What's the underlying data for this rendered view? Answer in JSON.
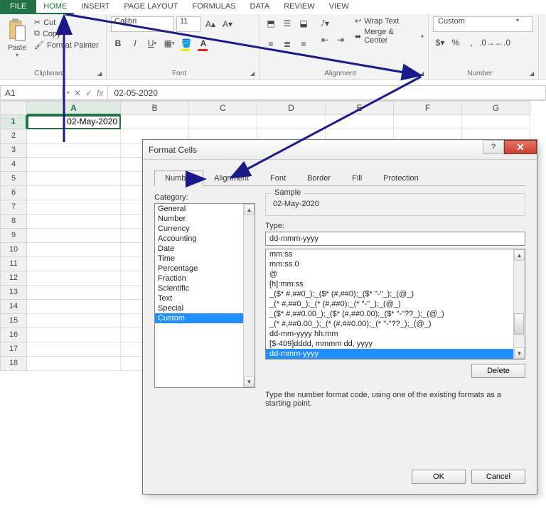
{
  "tabs": {
    "file": "FILE",
    "home": "HOME",
    "insert": "INSERT",
    "pagelayout": "PAGE LAYOUT",
    "formulas": "FORMULAS",
    "data": "DATA",
    "review": "REVIEW",
    "view": "VIEW"
  },
  "ribbon": {
    "clipboard": {
      "paste": "Paste",
      "cut": "Cut",
      "copy": "Copy",
      "format_painter": "Format Painter",
      "label": "Clipboard"
    },
    "font": {
      "name": "Calibri",
      "size": "11",
      "label": "Font"
    },
    "alignment": {
      "wrap": "Wrap Text",
      "merge": "Merge & Center",
      "label": "Alignment"
    },
    "number": {
      "format": "Custom",
      "label": "Number"
    }
  },
  "fbar": {
    "name_box": "A1",
    "formula": "02-05-2020",
    "fx": "fx"
  },
  "grid": {
    "cols": [
      "A",
      "B",
      "C",
      "D",
      "E",
      "F",
      "G"
    ],
    "rows": [
      "1",
      "2",
      "3",
      "4",
      "5",
      "6",
      "7",
      "8",
      "9",
      "10",
      "11",
      "12",
      "13",
      "14",
      "15",
      "16",
      "17",
      "18"
    ],
    "a1": "02-May-2020"
  },
  "dialog": {
    "title": "Format Cells",
    "tabs": {
      "number": "Number",
      "alignment": "Alignment",
      "font": "Font",
      "border": "Border",
      "fill": "Fill",
      "protection": "Protection"
    },
    "cat_label": "Category:",
    "categories": [
      "General",
      "Number",
      "Currency",
      "Accounting",
      "Date",
      "Time",
      "Percentage",
      "Fraction",
      "Scientific",
      "Text",
      "Special",
      "Custom"
    ],
    "sample_label": "Sample",
    "sample_value": "02-May-2020",
    "type_label": "Type:",
    "type_value": "dd-mmm-yyyy",
    "type_list": [
      "mm:ss",
      "mm:ss.0",
      "@",
      "[h]:mm:ss",
      "_($* #,##0_);_($* (#,##0);_($* \"-\"_);_(@_)",
      "_(* #,##0_);_(* (#,##0);_(* \"-\"_);_(@_)",
      "_($* #,##0.00_);_($* (#,##0.00);_($* \"-\"??_);_(@_)",
      "_(* #,##0.00_);_(* (#,##0.00);_(* \"-\"??_);_(@_)",
      "dd-mm-yyyy hh:mm",
      "[$-409]dddd, mmmm dd, yyyy",
      "dd-mmm-yyyy"
    ],
    "delete_btn": "Delete",
    "hint": "Type the number format code, using one of the existing formats as a starting point.",
    "ok": "OK",
    "cancel": "Cancel"
  }
}
